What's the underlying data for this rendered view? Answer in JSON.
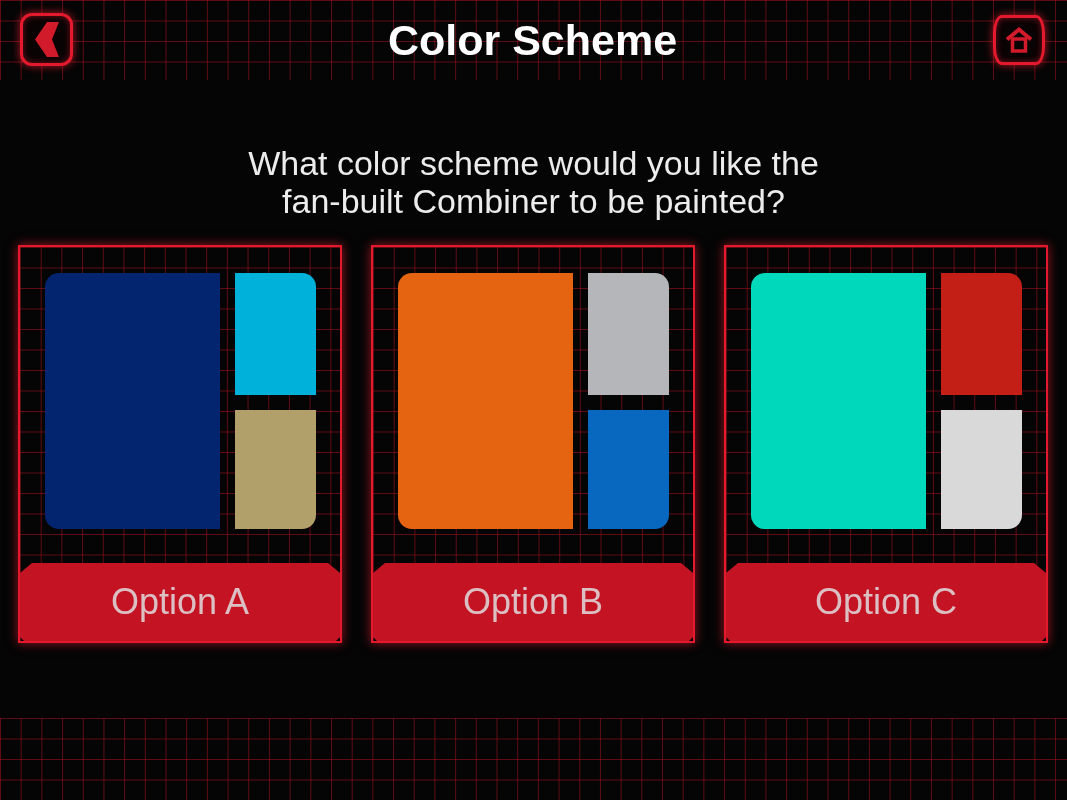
{
  "header": {
    "title": "Color Scheme"
  },
  "question": "What color scheme would you like the fan-built Combiner to be painted?",
  "options": [
    {
      "label": "Option A",
      "selected": false,
      "swatches": [
        {
          "color": "#03246e"
        },
        {
          "color": "#00b2da"
        },
        {
          "color": "#b2a06a"
        }
      ]
    },
    {
      "label": "Option B",
      "selected": false,
      "swatches": [
        {
          "color": "#e46412"
        },
        {
          "color": "#b4b6ba"
        },
        {
          "color": "#0868c0"
        }
      ]
    },
    {
      "label": "Option C",
      "selected": false,
      "swatches": [
        {
          "color": "#00d8bc"
        },
        {
          "color": "#c41f16"
        },
        {
          "color": "#d9d9d9"
        }
      ]
    }
  ]
}
